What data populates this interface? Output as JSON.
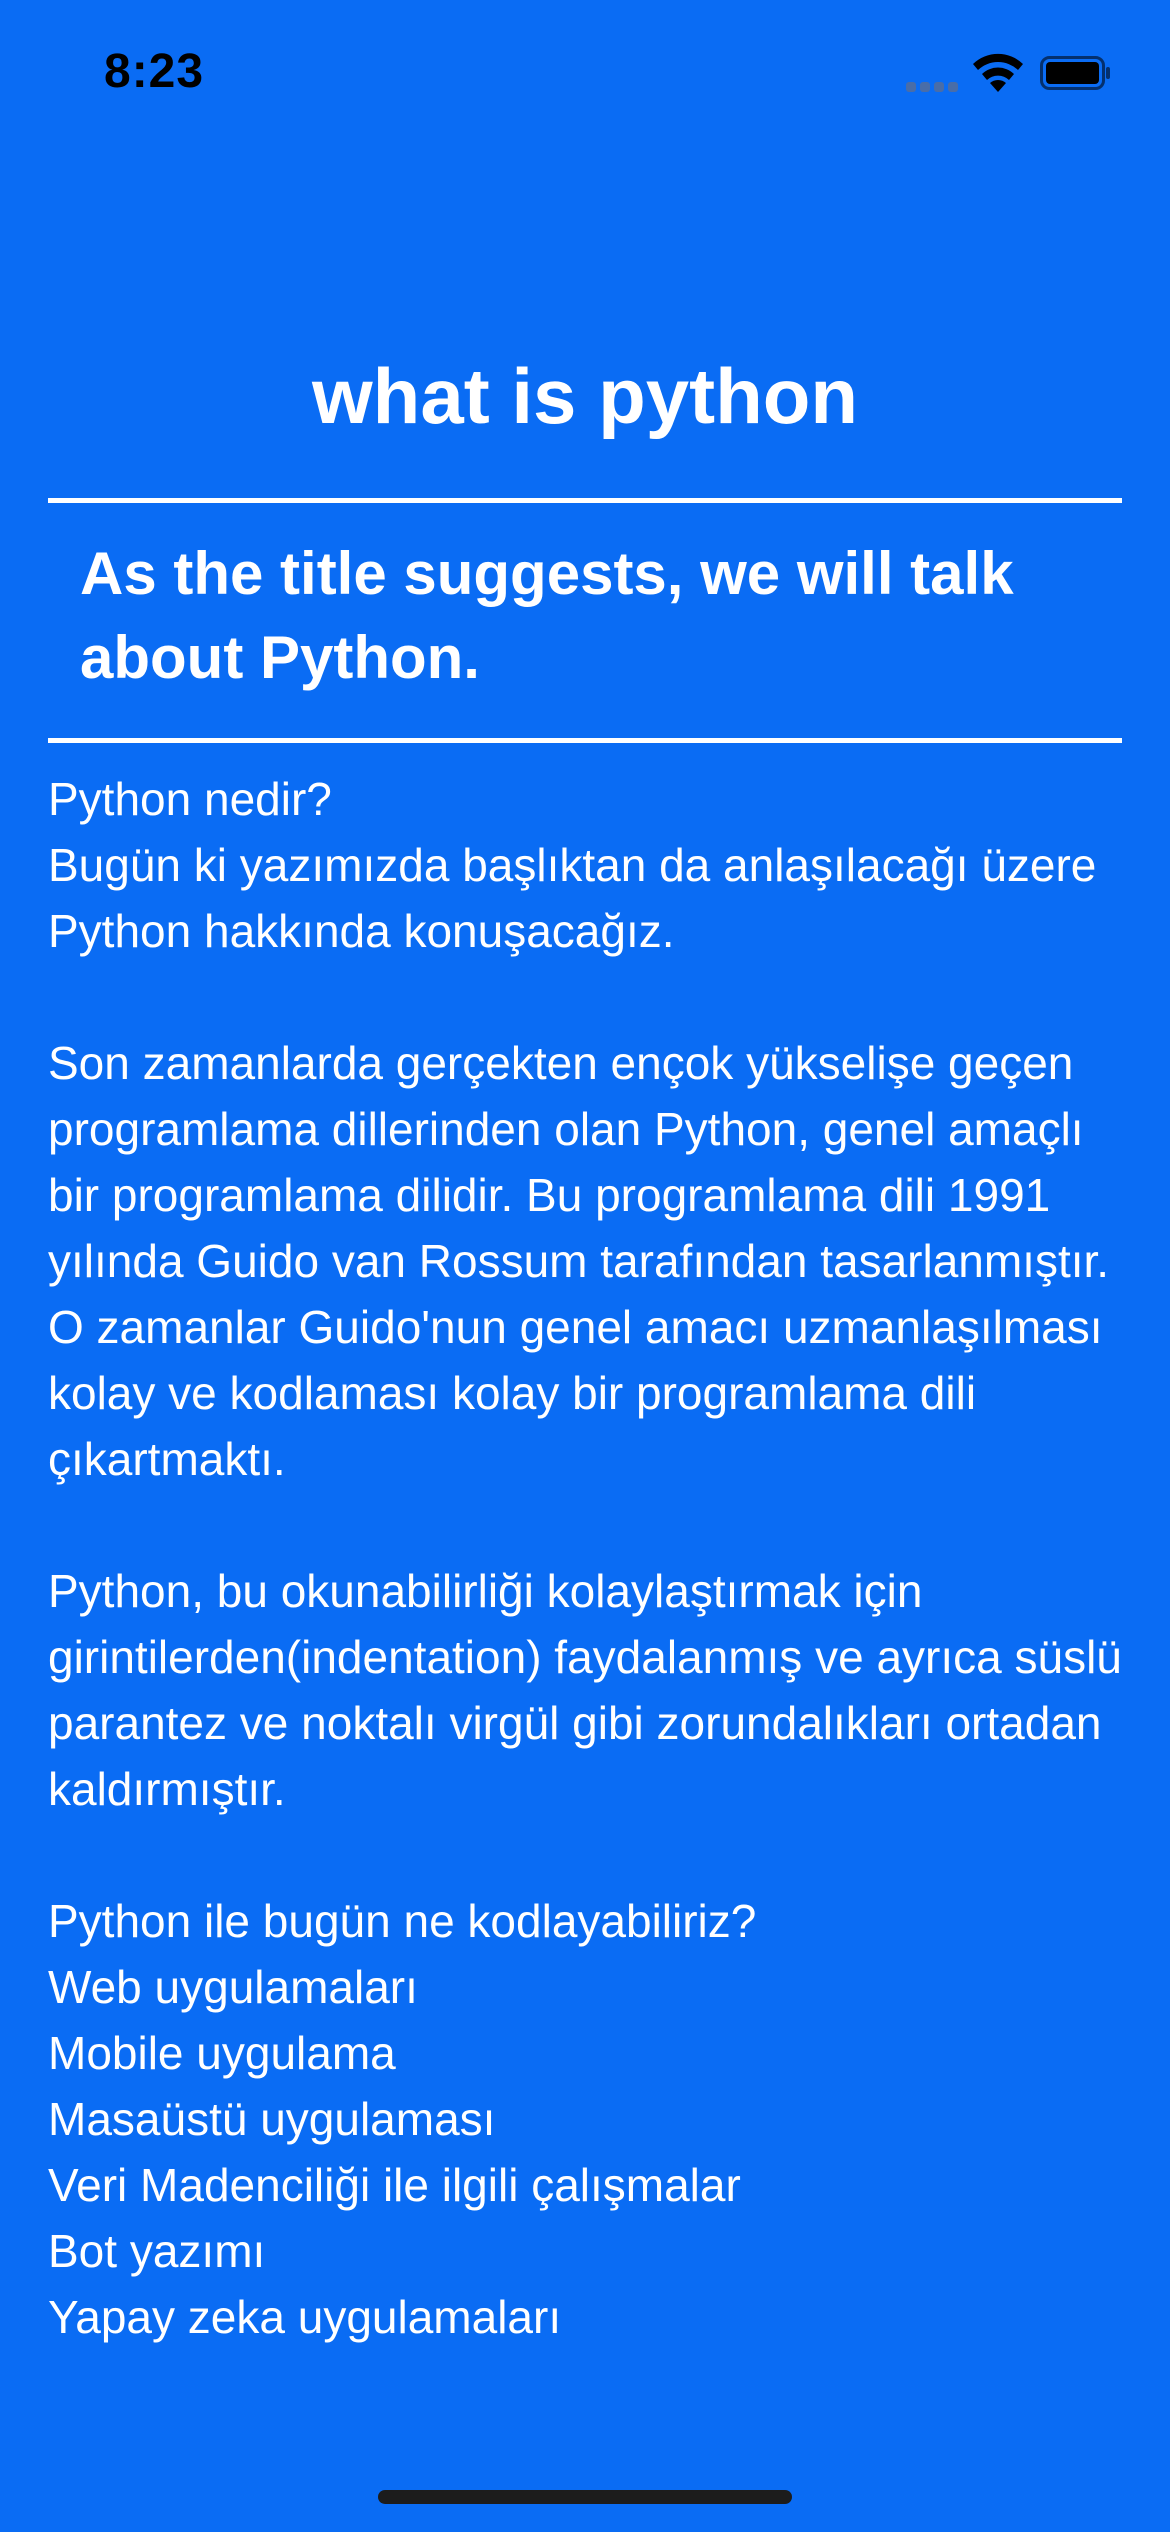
{
  "status_bar": {
    "time": "8:23",
    "icons": [
      "cellular-signal-icon",
      "wifi-icon",
      "battery-icon"
    ]
  },
  "page": {
    "title": "what is python",
    "subtitle": "As the title suggests, we will talk about Python.",
    "body": "Python nedir?\nBugün ki yazımızda başlıktan da anlaşılacağı üzere Python hakkında konuşacağız.\n\nSon zamanlarda gerçekten ençok yükselişe geçen programlama dillerinden olan Python, genel amaçlı bir programlama dilidir. Bu programlama dili 1991 yılında Guido van Rossum tarafından tasarlanmıştır. O zamanlar Guido'nun genel amacı uzmanlaşılması kolay ve kodlaması kolay bir programlama dili çıkartmaktı.\n\nPython, bu okunabilirliği kolaylaştırmak için girintilerden(indentation) faydalanmış ve ayrıca süslü parantez ve noktalı virgül gibi zorundalıkları ortadan kaldırmıştır.\n\nPython ile bugün ne kodlayabiliriz?\nWeb uygulamaları\nMobile uygulama\nMasaüstü uygulaması\nVeri Madenciliği ile ilgili çalışmalar\nBot yazımı\nYapay zeka uygulamaları"
  },
  "colors": {
    "background": "#0A6CF4",
    "text": "#FFFFFF",
    "status_text": "#000000"
  }
}
